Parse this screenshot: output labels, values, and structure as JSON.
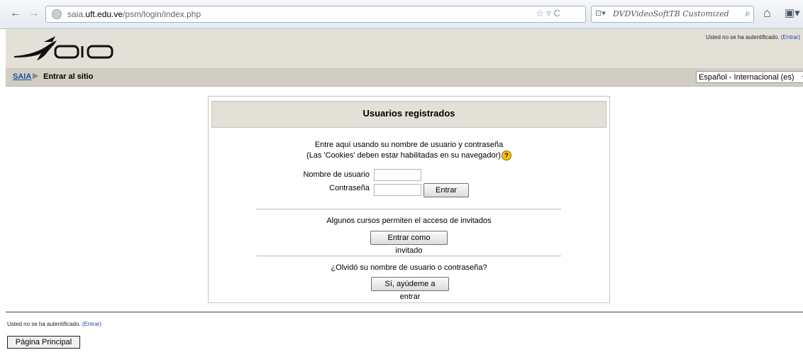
{
  "browser": {
    "back_icon": "←",
    "forward_icon": "→",
    "url_prefix": "saia.",
    "url_domain": "uft.edu.ve",
    "url_path": "/psm/login/index.php",
    "url_tools": "☆ ▿ C",
    "search_engine_icon": "⊡▾",
    "search_placeholder": "DVDVideoSoftTB Customized Web Searc",
    "search_go_icon": "⌕",
    "home_icon": "⌂",
    "menu_icon": "▣▾"
  },
  "header": {
    "auth_text": "Usted no se ha autentificado.",
    "auth_link": "(Entrar)"
  },
  "navbar": {
    "crumb_root": "SAIA",
    "crumb_sep": "▶",
    "crumb_current": "Entrar al sitio",
    "language": "Español - Internacional (es)",
    "language_arrow": "▼"
  },
  "login": {
    "title": "Usuarios registrados",
    "intro_line1": "Entre aquí usando su nombre de usuario y contraseña",
    "intro_line2": "(Las 'Cookies' deben estar habilitadas en su navegador)",
    "help_glyph": "?",
    "username_label": "Nombre de usuario",
    "password_label": "Contraseña",
    "submit_label": "Entrar",
    "guest_text": "Algunos cursos permiten el acceso de invitados",
    "guest_button": "Entrar como invitado",
    "forgot_text": "¿Olvidó su nombre de usuario o contraseña?",
    "forgot_button": "Sí, ayúdeme a entrar"
  },
  "footer": {
    "auth_text": "Usted no se ha autentificado.",
    "auth_link": "(Entrar)",
    "home_button": "Página Principal"
  },
  "colors": {
    "header_bg": "#e3e0d8",
    "navbar_bg": "#d1cdc2",
    "link": "#1a4aa8"
  }
}
